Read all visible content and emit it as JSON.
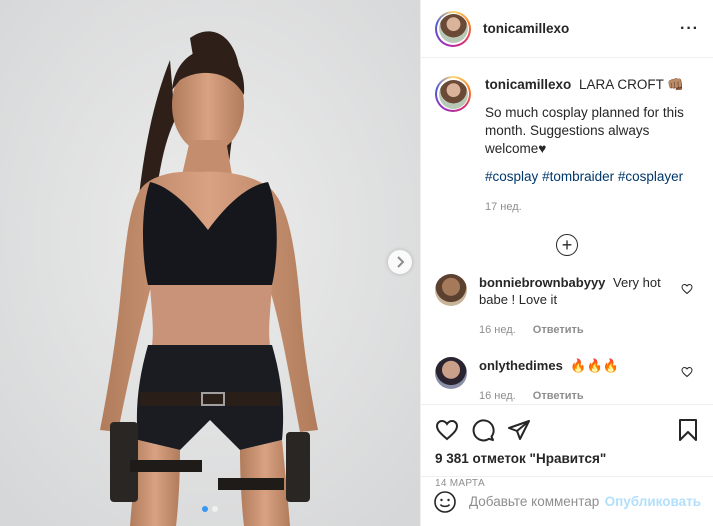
{
  "post": {
    "username": "tonicamillexo",
    "caption": {
      "username": "tonicamillexo",
      "title": "LARA CROFT 👊🏽",
      "body": "So much cosplay planned for this month. Suggestions always welcome♥",
      "hashtags": [
        "#cosplay",
        "#tombraider",
        "#cosplayer"
      ],
      "age": "17 нед."
    },
    "comments": [
      {
        "username": "bonniebrownbabyyy",
        "text": "Very hot babe ! Love it",
        "age": "16 нед.",
        "reply_label": "Ответить"
      },
      {
        "username": "onlythedimes",
        "text": "🔥🔥🔥",
        "age": "16 нед.",
        "reply_label": "Ответить"
      }
    ],
    "likes_text": "9 381 отметок \"Нравится\"",
    "date_text": "14 МАРТА",
    "add_comment": {
      "placeholder": "Добавьте комментарий...",
      "publish_label": "Опубликовать"
    },
    "carousel": {
      "total_slides": 2,
      "current_slide": 1
    }
  },
  "icons": {
    "more": "more-options-icon",
    "load_more": "plus-circle-icon",
    "like": "heart-icon",
    "comment": "comment-bubble-icon",
    "share": "paper-plane-icon",
    "save": "bookmark-icon",
    "emoji": "emoji-icon",
    "next": "chevron-right-icon"
  },
  "colors": {
    "link_blue": "#00376b",
    "publish_disabled": "#b2dffc",
    "meta_gray": "#8e8e8e",
    "text": "#262626",
    "active_dot": "#3897f0"
  }
}
